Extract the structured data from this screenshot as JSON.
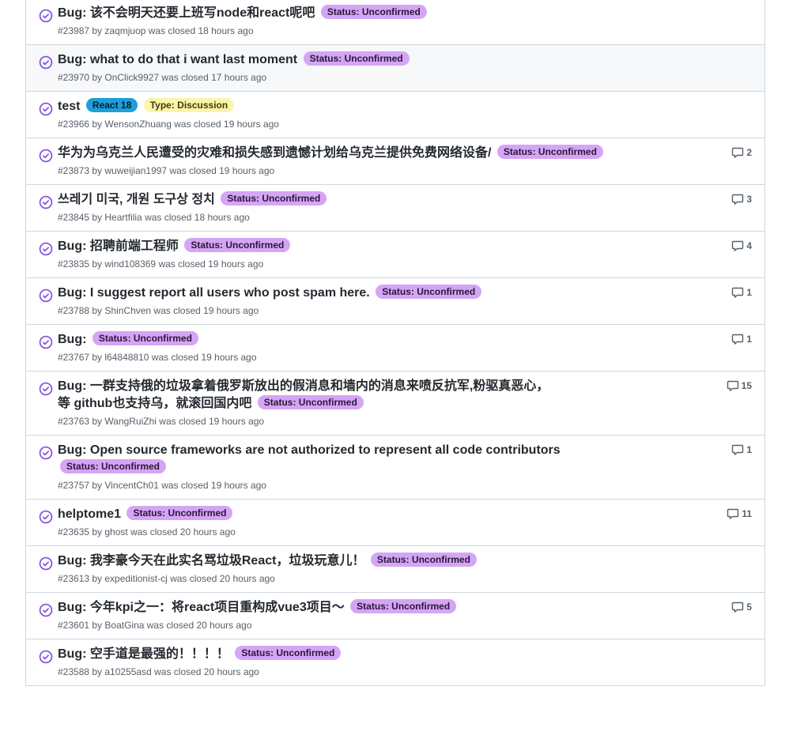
{
  "colors": {
    "closed_icon": "#8250df",
    "status_unconfirmed": "#d4a5f5",
    "react18": "#1d9fd9",
    "discussion": "#fbf5a8"
  },
  "issues": [
    {
      "title": "Bug: 该不会明天还要上班写node和react呢吧",
      "labels": [
        "Status: Unconfirmed"
      ],
      "meta": "#23987 by zaqmjuop was closed 18 hours ago",
      "comments": ""
    },
    {
      "title": "Bug: what to do that i want last moment",
      "labels": [
        "Status: Unconfirmed"
      ],
      "meta": "#23970 by OnClick9927 was closed 17 hours ago",
      "comments": ""
    },
    {
      "title": "test",
      "labels": [
        "React 18",
        "Type: Discussion"
      ],
      "meta": "#23966 by WensonZhuang was closed 19 hours ago",
      "comments": ""
    },
    {
      "title": "华为为乌克兰人民遭受的灾难和损失感到遗憾计划给乌克兰提供免费网络设备/",
      "labels": [
        "Status: Unconfirmed"
      ],
      "meta": "#23873 by wuweijian1997 was closed 19 hours ago",
      "comments": "2"
    },
    {
      "title": "쓰레기 미국, 개원 도구상 정치",
      "labels": [
        "Status: Unconfirmed"
      ],
      "meta": "#23845 by Heartfilia was closed 18 hours ago",
      "comments": "3"
    },
    {
      "title": "Bug: 招聘前端工程师",
      "labels": [
        "Status: Unconfirmed"
      ],
      "meta": "#23835 by wind108369 was closed 19 hours ago",
      "comments": "4"
    },
    {
      "title": "Bug: I suggest report all users who post spam here.",
      "labels": [
        "Status: Unconfirmed"
      ],
      "meta": "#23788 by ShinChven was closed 19 hours ago",
      "comments": "1"
    },
    {
      "title": "Bug:",
      "labels": [
        "Status: Unconfirmed"
      ],
      "meta": "#23767 by l64848810 was closed 19 hours ago",
      "comments": "1"
    },
    {
      "title": "Bug: 一群支持俄的垃圾拿着俄罗斯放出的假消息和墙内的消息来喷反抗军,粉驱真恶心，等 github也支持乌，就滚回国内吧",
      "labels": [
        "Status: Unconfirmed"
      ],
      "meta": "#23763 by WangRuiZhi was closed 19 hours ago",
      "comments": "15"
    },
    {
      "title": "Bug: Open source frameworks are not authorized to represent all code contributors",
      "labels": [
        "Status: Unconfirmed"
      ],
      "meta": "#23757 by VincentCh01 was closed 19 hours ago",
      "comments": "1"
    },
    {
      "title": "helptome1",
      "labels": [
        "Status: Unconfirmed"
      ],
      "meta": "#23635 by ghost was closed 20 hours ago",
      "comments": "11"
    },
    {
      "title": "Bug: 我李豪今天在此实名骂垃圾React，垃圾玩意儿！",
      "labels": [
        "Status: Unconfirmed"
      ],
      "meta": "#23613 by expeditionist-cj was closed 20 hours ago",
      "comments": ""
    },
    {
      "title": "Bug: 今年kpi之一：将react项目重构成vue3项目～",
      "labels": [
        "Status: Unconfirmed"
      ],
      "meta": "#23601 by BoatGina was closed 20 hours ago",
      "comments": "5"
    },
    {
      "title": "Bug: 空手道是最强的！！！！",
      "labels": [
        "Status: Unconfirmed"
      ],
      "meta": "#23588 by a10255asd was closed 20 hours ago",
      "comments": ""
    }
  ]
}
